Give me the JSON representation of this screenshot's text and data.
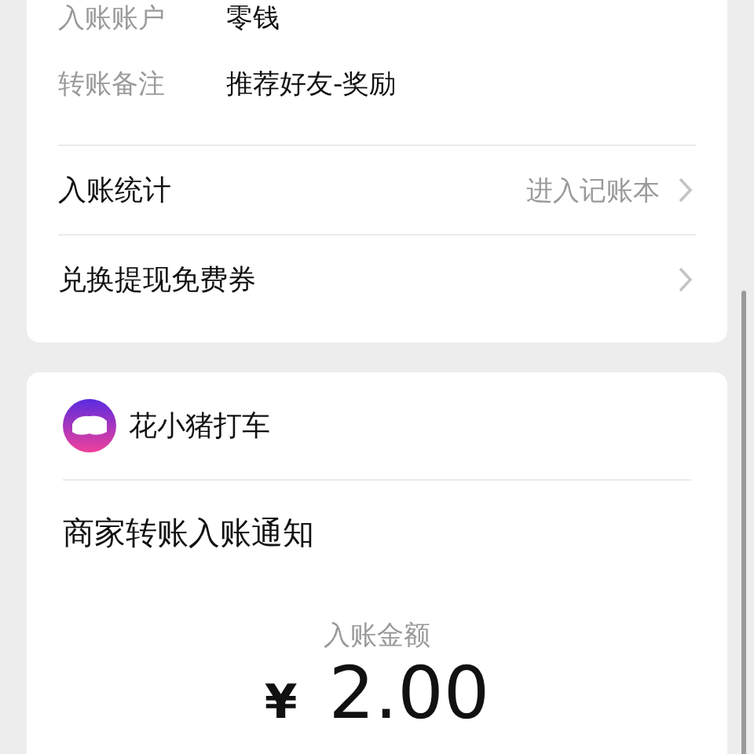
{
  "details": [
    {
      "label": "入账账户",
      "value": "零钱"
    },
    {
      "label": "转账备注",
      "value": "推荐好友-奖励"
    }
  ],
  "links": [
    {
      "label": "入账统计",
      "hint": "进入记账本"
    },
    {
      "label": "兑换提现免费券"
    }
  ],
  "merchant": {
    "name": "花小猪打车"
  },
  "notice": {
    "title": "商家转账入账通知",
    "amount_label": "入账金额",
    "currency": "¥",
    "amount": "2.00"
  }
}
